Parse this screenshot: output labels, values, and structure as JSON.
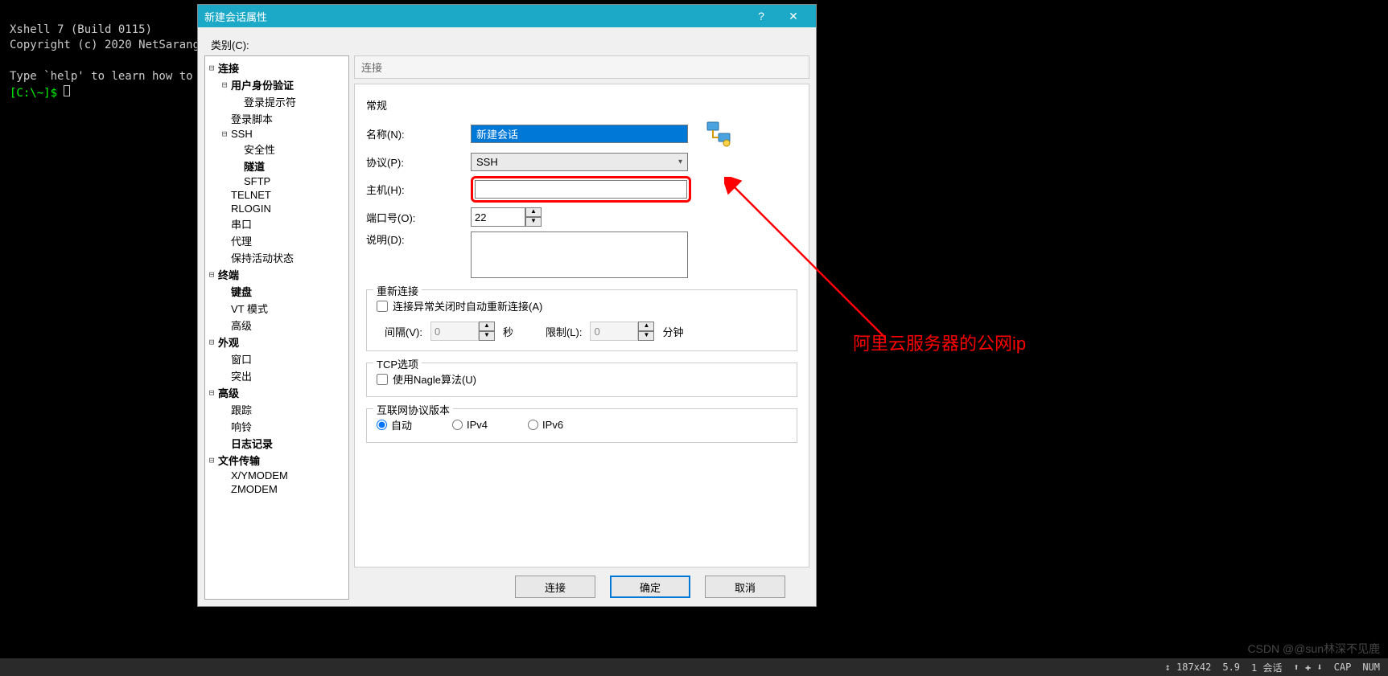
{
  "terminal": {
    "line1": "Xshell 7 (Build 0115)",
    "line2": "Copyright (c) 2020 NetSarang",
    "line3": "Type `help' to learn how to",
    "prompt": "[C:\\~]$ "
  },
  "dialog": {
    "title": "新建会话属性",
    "help_btn": "?",
    "close_btn": "✕",
    "category_label": "类别(C):"
  },
  "tree": [
    {
      "label": "连接",
      "indent": 0,
      "bold": true,
      "toggle": "⊟"
    },
    {
      "label": "用户身份验证",
      "indent": 1,
      "bold": true,
      "toggle": "⊟"
    },
    {
      "label": "登录提示符",
      "indent": 2,
      "bold": false,
      "toggle": ""
    },
    {
      "label": "登录脚本",
      "indent": 1,
      "bold": false,
      "toggle": ""
    },
    {
      "label": "SSH",
      "indent": 1,
      "bold": false,
      "toggle": "⊟"
    },
    {
      "label": "安全性",
      "indent": 2,
      "bold": false,
      "toggle": ""
    },
    {
      "label": "隧道",
      "indent": 2,
      "bold": true,
      "toggle": ""
    },
    {
      "label": "SFTP",
      "indent": 2,
      "bold": false,
      "toggle": ""
    },
    {
      "label": "TELNET",
      "indent": 1,
      "bold": false,
      "toggle": ""
    },
    {
      "label": "RLOGIN",
      "indent": 1,
      "bold": false,
      "toggle": ""
    },
    {
      "label": "串口",
      "indent": 1,
      "bold": false,
      "toggle": ""
    },
    {
      "label": "代理",
      "indent": 1,
      "bold": false,
      "toggle": ""
    },
    {
      "label": "保持活动状态",
      "indent": 1,
      "bold": false,
      "toggle": ""
    },
    {
      "label": "终端",
      "indent": 0,
      "bold": true,
      "toggle": "⊟"
    },
    {
      "label": "键盘",
      "indent": 1,
      "bold": true,
      "toggle": ""
    },
    {
      "label": "VT 模式",
      "indent": 1,
      "bold": false,
      "toggle": ""
    },
    {
      "label": "高级",
      "indent": 1,
      "bold": false,
      "toggle": ""
    },
    {
      "label": "外观",
      "indent": 0,
      "bold": true,
      "toggle": "⊟"
    },
    {
      "label": "窗口",
      "indent": 1,
      "bold": false,
      "toggle": ""
    },
    {
      "label": "突出",
      "indent": 1,
      "bold": false,
      "toggle": ""
    },
    {
      "label": "高级",
      "indent": 0,
      "bold": true,
      "toggle": "⊟"
    },
    {
      "label": "跟踪",
      "indent": 1,
      "bold": false,
      "toggle": ""
    },
    {
      "label": "响铃",
      "indent": 1,
      "bold": false,
      "toggle": ""
    },
    {
      "label": "日志记录",
      "indent": 1,
      "bold": true,
      "toggle": ""
    },
    {
      "label": "文件传输",
      "indent": 0,
      "bold": true,
      "toggle": "⊟"
    },
    {
      "label": "X/YMODEM",
      "indent": 1,
      "bold": false,
      "toggle": ""
    },
    {
      "label": "ZMODEM",
      "indent": 1,
      "bold": false,
      "toggle": ""
    }
  ],
  "form": {
    "section_header": "连接",
    "group_general": "常规",
    "name_label": "名称(N):",
    "name_value": "新建会话",
    "protocol_label": "协议(P):",
    "protocol_value": "SSH",
    "host_label": "主机(H):",
    "host_value": "",
    "port_label": "端口号(O):",
    "port_value": "22",
    "desc_label": "说明(D):",
    "desc_value": "",
    "group_reconnect": "重新连接",
    "reconnect_checkbox": "连接异常关闭时自动重新连接(A)",
    "interval_label": "间隔(V):",
    "interval_value": "0",
    "interval_unit": "秒",
    "limit_label": "限制(L):",
    "limit_value": "0",
    "limit_unit": "分钟",
    "group_tcp": "TCP选项",
    "nagle_checkbox": "使用Nagle算法(U)",
    "group_ipver": "互联网协议版本",
    "radio_auto": "自动",
    "radio_ipv4": "IPv4",
    "radio_ipv6": "IPv6"
  },
  "buttons": {
    "connect": "连接",
    "ok": "确定",
    "cancel": "取消"
  },
  "annotation": "阿里云服务器的公网ip",
  "statusbar": {
    "size": "↕ 187x42",
    "val": "5.9",
    "sessions": "1 会话",
    "cap": "CAP",
    "num": "NUM"
  },
  "watermark": "CSDN @@sun林深不见鹿"
}
